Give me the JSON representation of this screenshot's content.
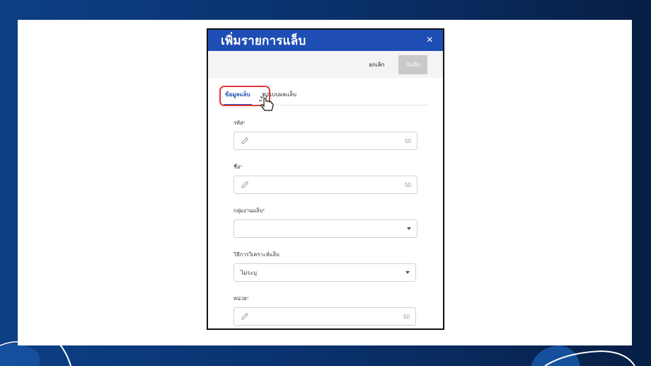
{
  "dialog": {
    "title": "เพิ่มรายการแล็บ",
    "close_symbol": "×",
    "cancel_label": "ยกเลิก",
    "save_label": "บันทึก"
  },
  "tabs": [
    {
      "label": "ข้อมูลแล็บ",
      "active": true
    },
    {
      "label": "รูปแบบผลแล็บ",
      "active": false
    }
  ],
  "fields": {
    "code": {
      "label": "รหัส",
      "required_mark": "*",
      "value": "",
      "counter": "50"
    },
    "name": {
      "label": "ชื่อ",
      "required_mark": "*",
      "value": "",
      "counter": "50"
    },
    "lab_group": {
      "label": "กลุ่มงานแล็บ",
      "required_mark": "*",
      "selected": ""
    },
    "analysis_method": {
      "label": "วิธีการวิเคราะห์แล็บ",
      "selected": "ไม่ระบุ"
    },
    "unit": {
      "label": "หน่วย",
      "required_mark": "*",
      "value": "",
      "counter": "50"
    }
  },
  "icons": {
    "close": "close-icon",
    "edit": "pencil-icon",
    "dropdown": "caret-down-icon",
    "pointer": "hand-pointer-icon"
  },
  "colors": {
    "header": "#1e4db4",
    "highlight": "#e03a3a",
    "background_left": "#0c3f84",
    "background_right": "#071f45"
  }
}
